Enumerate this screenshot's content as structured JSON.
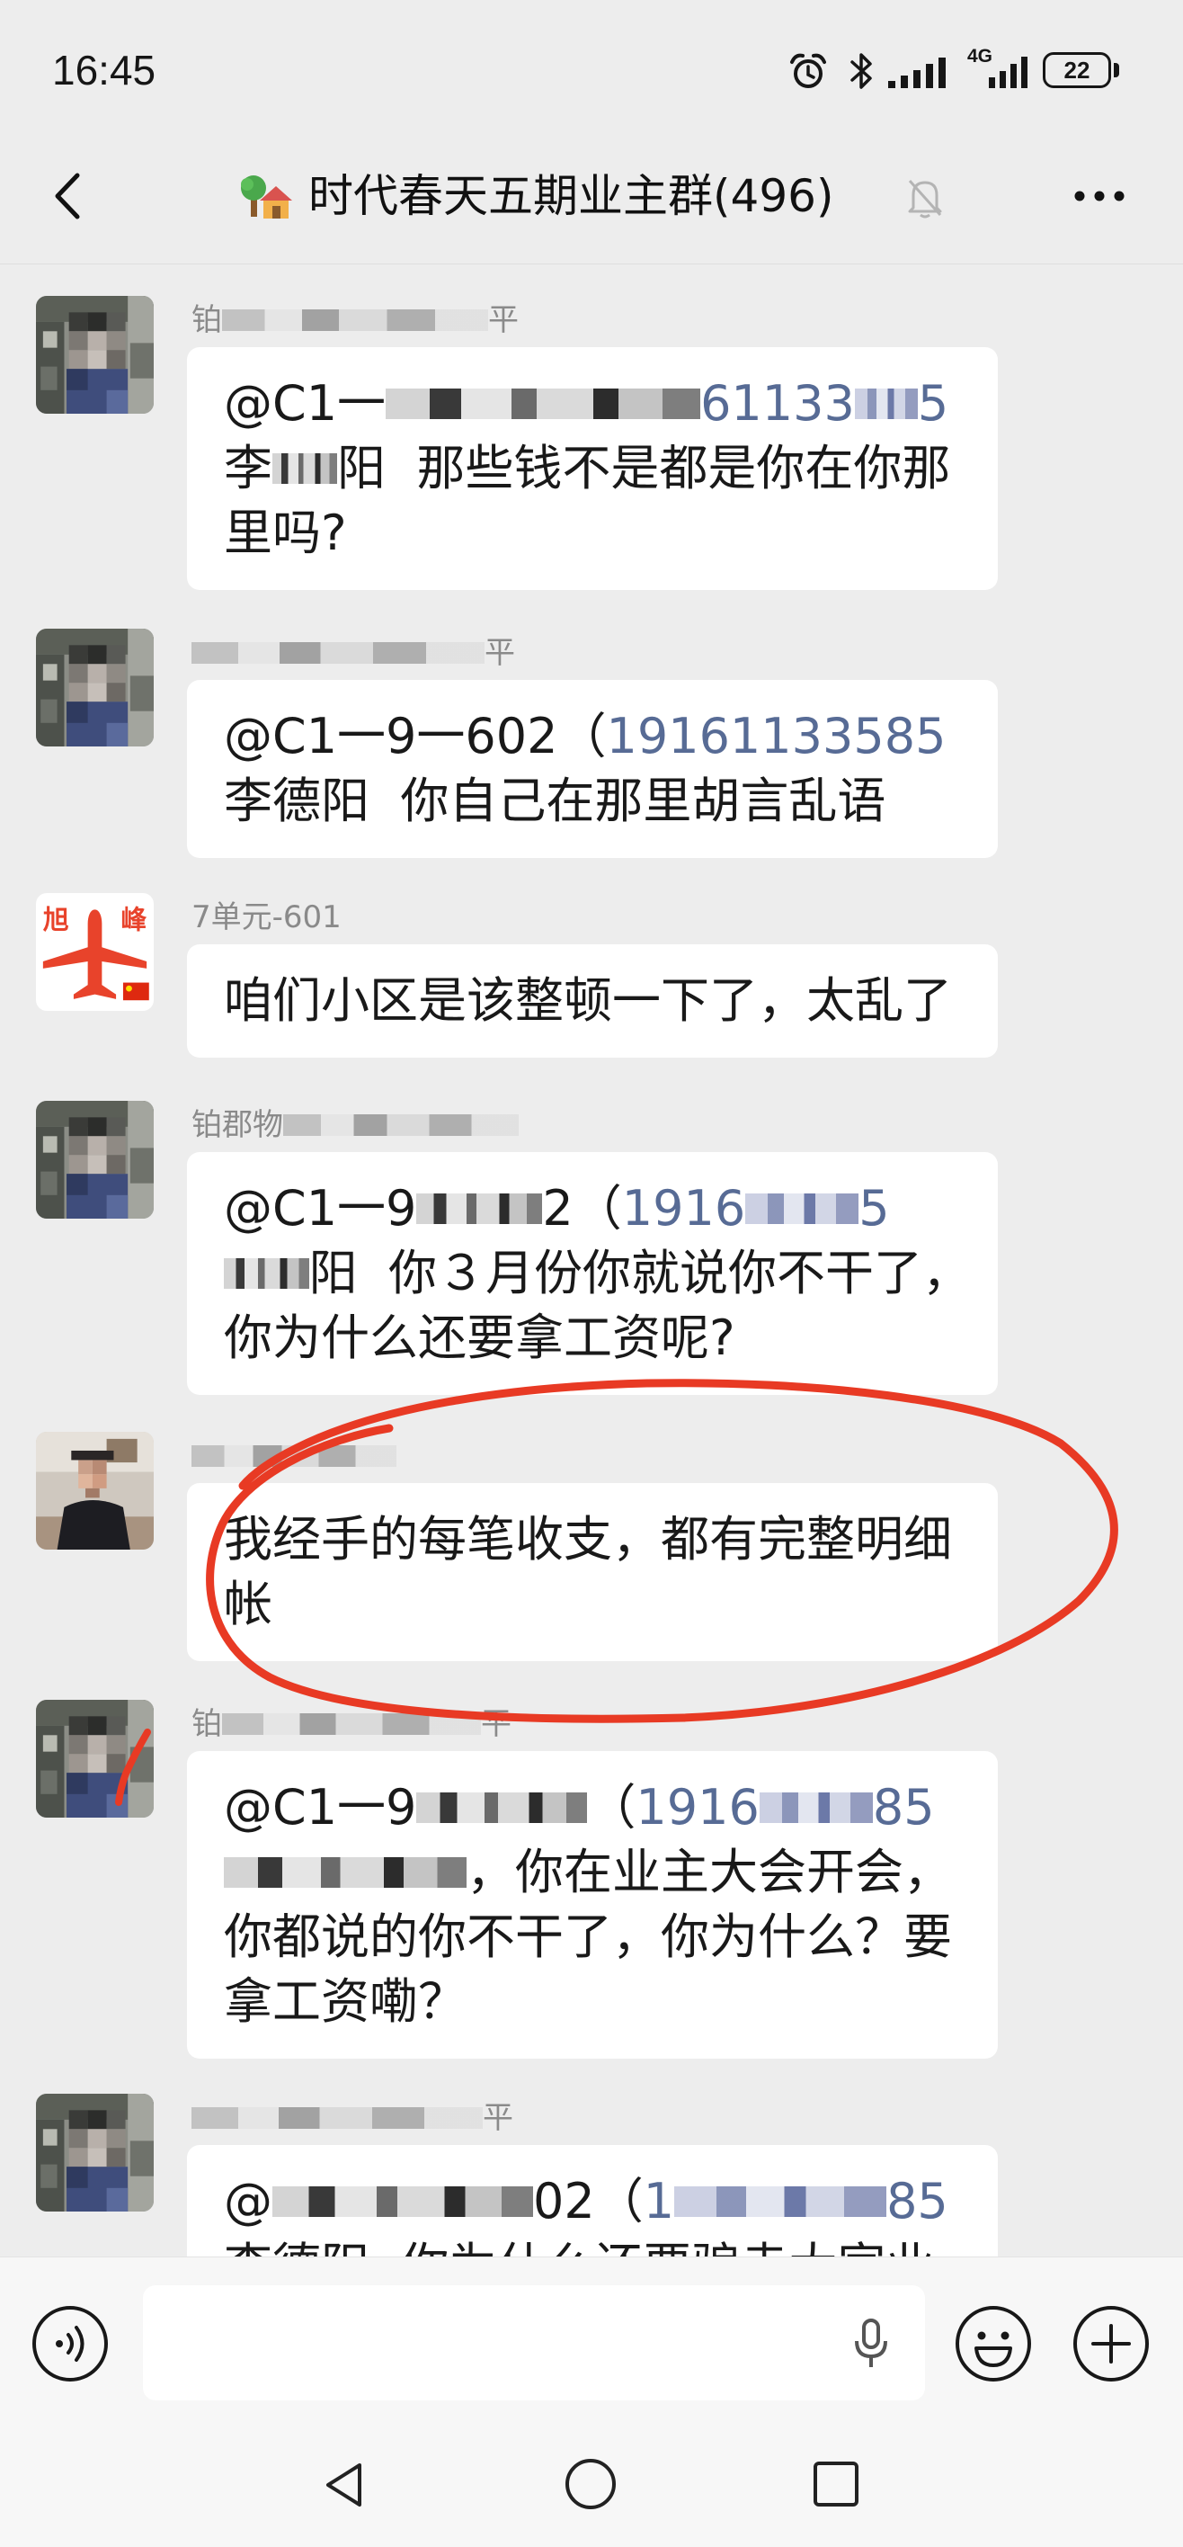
{
  "status_bar": {
    "time": "16:45",
    "network_label": "4G",
    "battery_level": "22",
    "icons": [
      "alarm-icon",
      "bluetooth-icon",
      "signal-icon",
      "signal-4g-icon",
      "battery-icon"
    ]
  },
  "header": {
    "title": "时代春天五期业主群(496)",
    "icons": {
      "back": "chevron-left-icon",
      "group": "house-tree-icon",
      "muted": "bell-muted-icon",
      "more": "more-dots-icon"
    }
  },
  "messages": [
    {
      "sender": [
        "铂",
        "平"
      ],
      "lines": [
        [
          "@C1一",
          "61133",
          "5"
        ],
        [
          "李",
          "阳  那些钱不是都是你在你那"
        ],
        [
          "里吗?"
        ]
      ]
    },
    {
      "sender": [
        "平"
      ],
      "lines": [
        [
          "@C1一9一602（",
          "19161133585"
        ],
        [
          "李德阳  你自己在那里胡言乱语"
        ]
      ]
    },
    {
      "sender": [
        "7单元-601"
      ],
      "avatar_text": [
        "旭",
        "峰"
      ],
      "lines": [
        [
          "咱们小区是该整顿一下了，太乱了"
        ]
      ]
    },
    {
      "sender": [
        "铂郡物"
      ],
      "lines": [
        [
          "@C1一9",
          "2（",
          "1916",
          "5"
        ],
        [
          "阳  你３月份你就说你不干了，"
        ],
        [
          "你为什么还要拿工资呢?"
        ]
      ]
    },
    {
      "lines": [
        [
          "我经手的每笔收支，都有完整明细"
        ],
        [
          "帐"
        ]
      ]
    },
    {
      "sender": [
        "铂",
        "平"
      ],
      "lines": [
        [
          "@C1一9",
          "（",
          "1916",
          "85"
        ],
        [
          "，你在业主大会开会，"
        ],
        [
          "你都说的你不干了，你为什么？要"
        ],
        [
          "拿工资嘞？"
        ]
      ]
    },
    {
      "sender": [
        "平"
      ],
      "lines": [
        [
          "@",
          "02（",
          "1",
          "85"
        ],
        [
          "李德阳  你为什么还要骗走大家业"
        ]
      ]
    }
  ],
  "input_bar": {
    "text": "",
    "icons": {
      "voice": "voice-icon",
      "mic": "mic-icon",
      "emoji": "emoji-icon",
      "plus": "plus-icon"
    }
  },
  "nav_bar": {
    "icons": [
      "back-triangle-icon",
      "home-circle-icon",
      "recents-square-icon"
    ]
  },
  "colors": {
    "background": "#ededed",
    "bubble": "#ffffff",
    "text": "#191919",
    "sender_name": "#8a8a8a",
    "mention_link": "#576b95",
    "annotation_red": "#e83a24",
    "bar_background": "#f7f7f7"
  }
}
